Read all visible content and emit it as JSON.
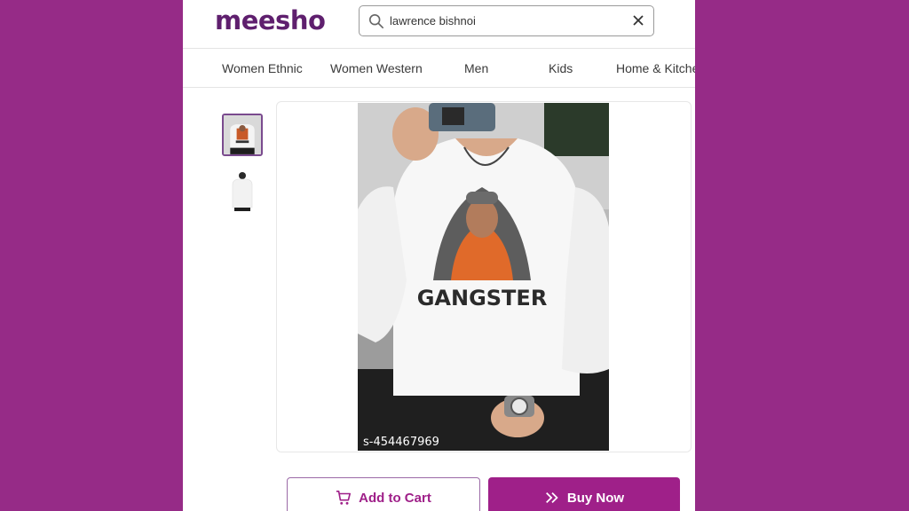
{
  "header": {
    "logo": "meesho",
    "search_value": "lawrence bishnoi"
  },
  "nav": {
    "items": [
      "Women Ethnic",
      "Women Western",
      "Men",
      "Kids",
      "Home & Kitche"
    ]
  },
  "product": {
    "shirt_print_text": "GANGSTER",
    "sku": "s-454467969"
  },
  "actions": {
    "add_to_cart": "Add to Cart",
    "buy_now": "Buy Now"
  },
  "colors": {
    "background": "#962b87",
    "brand": "#9f2089",
    "logo": "#5f1f6e"
  },
  "icons": [
    "search-icon",
    "clear-icon",
    "cart-icon",
    "double-chevron-icon"
  ]
}
